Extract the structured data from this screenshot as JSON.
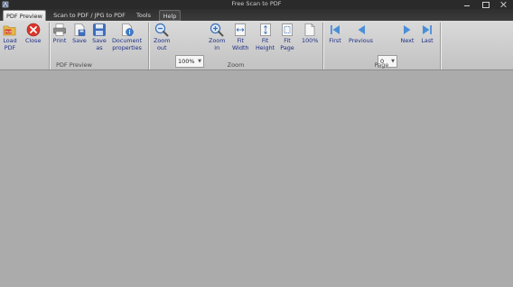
{
  "window": {
    "title": "Free Scan to PDF"
  },
  "tabs": [
    {
      "label": "PDF Preview"
    },
    {
      "label": "Scan to PDF / JPG to PDF"
    },
    {
      "label": "Tools"
    },
    {
      "label": "Help"
    }
  ],
  "groups": {
    "pdf_preview": {
      "label": "PDF Preview",
      "buttons": [
        {
          "label": "Load\nPDF",
          "icon": "folder-pdf-icon"
        },
        {
          "label": "Close",
          "icon": "close-circle-icon"
        },
        {
          "label": "Print",
          "icon": "printer-icon"
        },
        {
          "label": "Save",
          "icon": "save-document-icon"
        },
        {
          "label": "Save\nas",
          "icon": "save-as-disk-icon"
        },
        {
          "label": "Document\nproperties",
          "icon": "document-properties-icon"
        }
      ]
    },
    "zoom": {
      "label": "Zoom",
      "zoom_value": "100%",
      "buttons": [
        {
          "label": "Zoom\nout",
          "icon": "zoom-out-icon"
        },
        {
          "label": "Zoom\nin",
          "icon": "zoom-in-icon"
        },
        {
          "label": "Fit\nWidth",
          "icon": "fit-width-icon"
        },
        {
          "label": "Fit\nHeight",
          "icon": "fit-height-icon"
        },
        {
          "label": "Fit\nPage",
          "icon": "fit-page-icon"
        },
        {
          "label": "100%",
          "icon": "actual-size-icon"
        }
      ]
    },
    "page": {
      "label": "Page",
      "page_value": "0",
      "buttons": [
        {
          "label": "First",
          "icon": "first-page-icon"
        },
        {
          "label": "Previous",
          "icon": "previous-page-icon"
        },
        {
          "label": "Next",
          "icon": "next-page-icon"
        },
        {
          "label": "Last",
          "icon": "last-page-icon"
        }
      ]
    }
  },
  "colors": {
    "ribbon_label": "#1e2f86",
    "nav_blue": "#4a8fd8",
    "viewer_bg": "#ababab"
  }
}
